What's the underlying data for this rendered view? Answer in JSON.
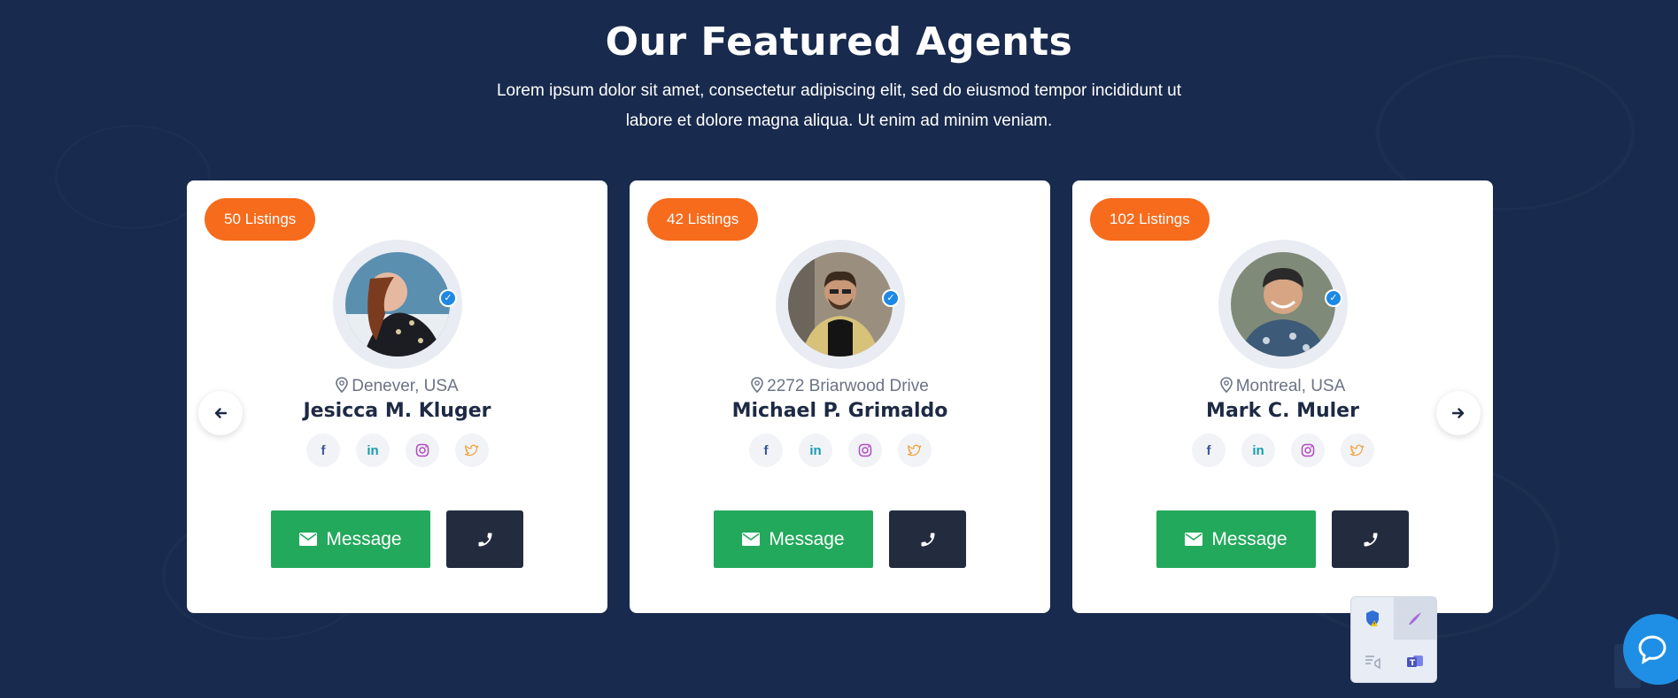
{
  "section": {
    "title": "Our Featured Agents",
    "description_line1": "Lorem ipsum dolor sit amet, consectetur adipiscing elit, sed do eiusmod tempor incididunt ut",
    "description_line2": "labore et dolore magna aliqua. Ut enim ad minim veniam."
  },
  "agents": [
    {
      "listings": "50 Listings",
      "location": "Denever, USA",
      "name": "Jesicca M. Kluger",
      "message_label": "Message",
      "verified": true
    },
    {
      "listings": "42 Listings",
      "location": "2272 Briarwood Drive",
      "name": "Michael P. Grimaldo",
      "message_label": "Message",
      "verified": true
    },
    {
      "listings": "102 Listings",
      "location": "Montreal, USA",
      "name": "Mark C. Muler",
      "message_label": "Message",
      "verified": true
    }
  ],
  "social_icons": [
    "facebook-icon",
    "linkedin-icon",
    "instagram-icon",
    "twitter-icon"
  ],
  "colors": {
    "background": "#182a4d",
    "badge": "#f76b1c",
    "message_button": "#23a95c",
    "call_button": "#232b3f",
    "verified": "#1e88e5",
    "chat_widget": "#1f8fe5"
  }
}
